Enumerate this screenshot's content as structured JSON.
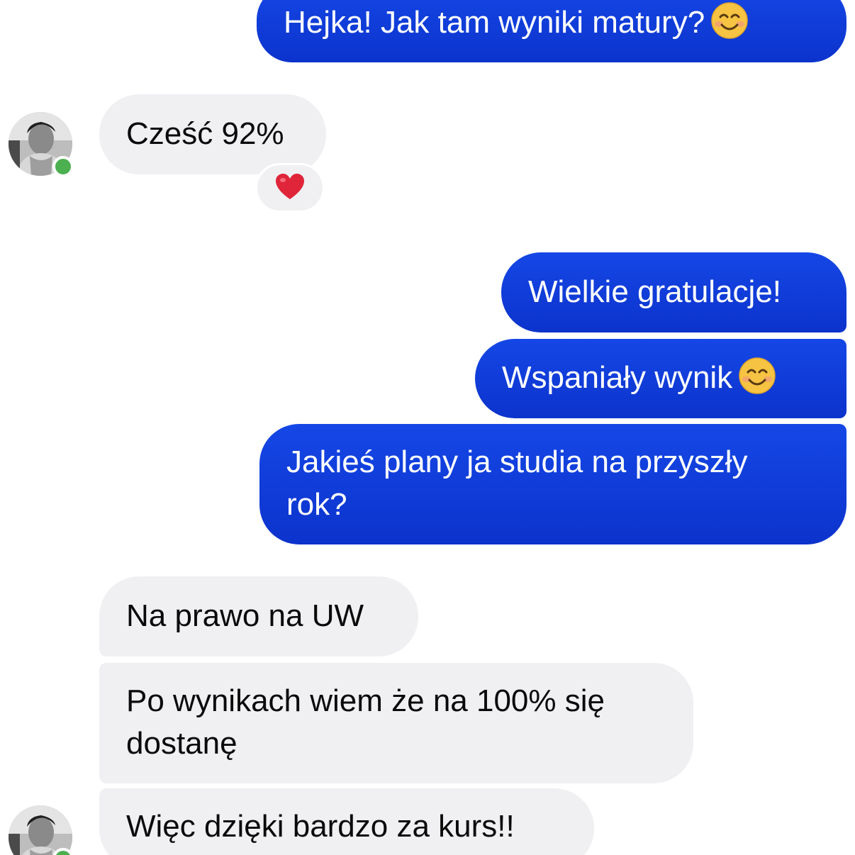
{
  "colors": {
    "outgoing_bubble": "#1547e6",
    "incoming_bubble": "#f0f0f3",
    "online_dot": "#4caf50",
    "reaction_heart": "#e0253a"
  },
  "messages": {
    "m1": {
      "text": "Hejka! Jak tam wyniki matury?",
      "emoji": "smiling-face-icon"
    },
    "m2": {
      "text": "Cześć 92%",
      "reaction": "red-heart-icon"
    },
    "m3": {
      "text": "Wielkie gratulacje!"
    },
    "m4": {
      "text": "Wspaniały wynik",
      "emoji": "smiling-face-icon"
    },
    "m5": {
      "line1": "Jakieś plany ja studia na przyszły",
      "line2": "rok?"
    },
    "m6": {
      "text": "Na prawo na UW"
    },
    "m7": {
      "line1": "Po wynikach wiem że na 100% się",
      "line2": "dostanę"
    },
    "m8": {
      "text": "Więc dzięki bardzo za kurs!!"
    }
  }
}
